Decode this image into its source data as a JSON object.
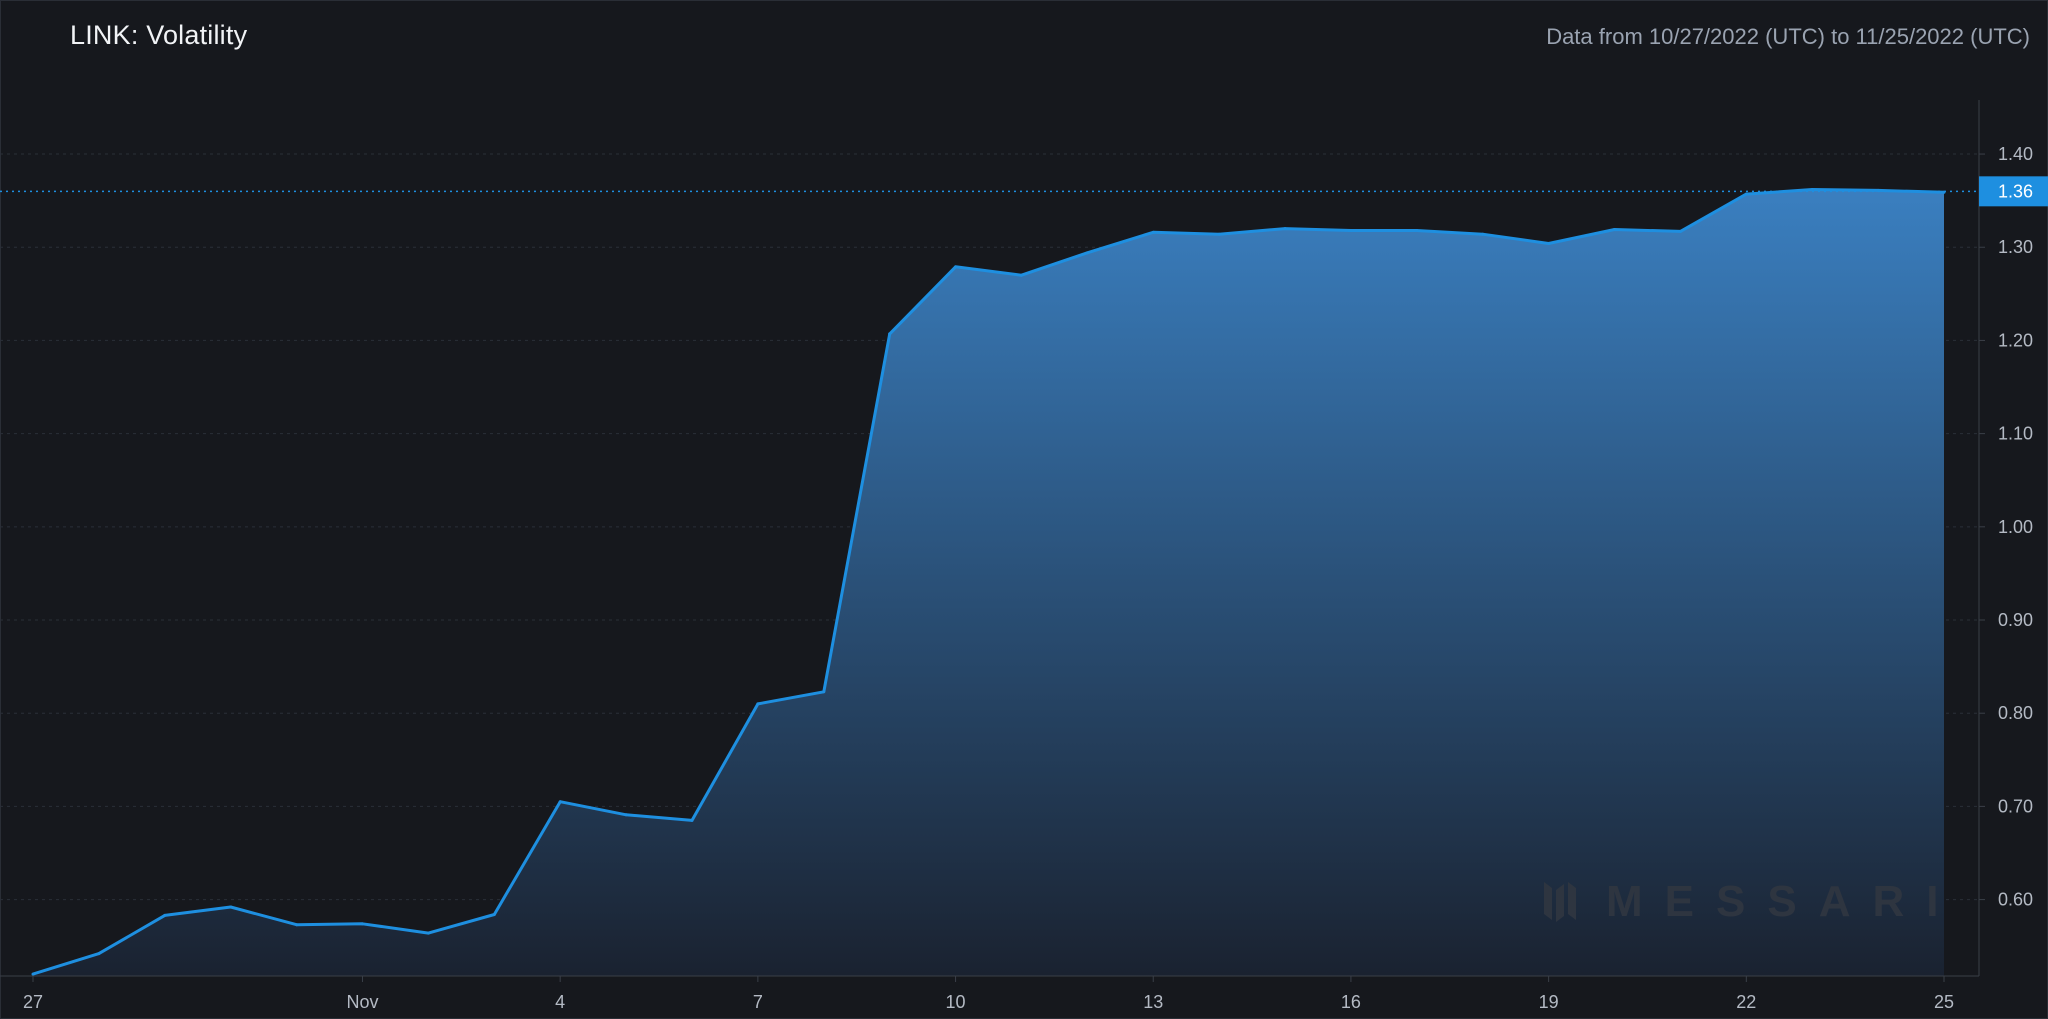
{
  "header": {
    "title": "LINK: Volatility",
    "date_range": "Data from 10/27/2022 (UTC) to 11/25/2022 (UTC)"
  },
  "watermark": {
    "text": "MESSARI"
  },
  "colors": {
    "background": "#16181d",
    "line": "#1e8fe0",
    "fill_top": "#3a7fc0",
    "fill_bottom": "#1a2230",
    "last_value_badge": "#1e8fe0"
  },
  "chart_data": {
    "type": "area",
    "title": "LINK: Volatility",
    "x_tick_labels": [
      {
        "day": 0,
        "label": "27"
      },
      {
        "day": 5,
        "label": "Nov"
      },
      {
        "day": 8,
        "label": "4"
      },
      {
        "day": 11,
        "label": "7"
      },
      {
        "day": 14,
        "label": "10"
      },
      {
        "day": 17,
        "label": "13"
      },
      {
        "day": 20,
        "label": "16"
      },
      {
        "day": 23,
        "label": "19"
      },
      {
        "day": 26,
        "label": "22"
      },
      {
        "day": 29,
        "label": "25"
      }
    ],
    "y_ticks": [
      "0.60",
      "0.70",
      "0.80",
      "0.90",
      "1.00",
      "1.10",
      "1.20",
      "1.30",
      "1.40"
    ],
    "ylim": [
      0.518,
      1.458
    ],
    "grid": true,
    "series": [
      {
        "values": [
          0.52,
          0.542,
          0.583,
          0.592,
          0.573,
          0.574,
          0.564,
          0.584,
          0.705,
          0.691,
          0.685,
          0.81,
          0.823,
          1.207,
          1.279,
          1.27,
          1.294,
          1.316,
          1.314,
          1.32,
          1.318,
          1.318,
          1.314,
          1.304,
          1.319,
          1.317,
          1.357,
          1.362,
          1.361,
          1.359
        ]
      }
    ],
    "last_value_label": "1.36"
  }
}
